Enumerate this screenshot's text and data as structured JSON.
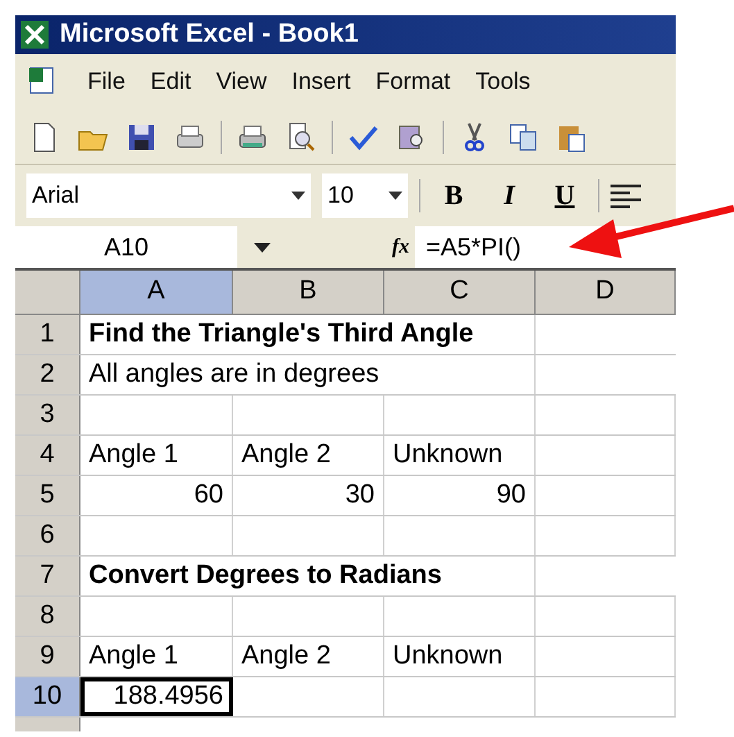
{
  "window": {
    "title": "Microsoft Excel - Book1"
  },
  "menu": [
    {
      "label": "File"
    },
    {
      "label": "Edit"
    },
    {
      "label": "View"
    },
    {
      "label": "Insert"
    },
    {
      "label": "Format"
    },
    {
      "label": "Tools"
    }
  ],
  "formatting": {
    "font": "Arial",
    "size": "10",
    "bold_button": "B",
    "italic_button": "I",
    "underline_button": "U"
  },
  "formula_bar": {
    "name_box": "A10",
    "fx": "fx",
    "formula": "=A5*PI()"
  },
  "columns": [
    {
      "label": "A",
      "selected": true
    },
    {
      "label": "B",
      "selected": false
    },
    {
      "label": "C",
      "selected": false
    },
    {
      "label": "D",
      "selected": false
    }
  ],
  "rows": [
    {
      "number": "1",
      "selected": false,
      "kind": "heading",
      "text": "Find the Triangle's Third Angle"
    },
    {
      "number": "2",
      "selected": false,
      "kind": "note",
      "text": "All angles are in degrees"
    },
    {
      "number": "3",
      "selected": false,
      "kind": "cells",
      "cells": []
    },
    {
      "number": "4",
      "selected": false,
      "kind": "cells",
      "cells": [
        {
          "text": "Angle 1",
          "kind": "label",
          "selected": false
        },
        {
          "text": "Angle 2",
          "kind": "label",
          "selected": false
        },
        {
          "text": "Unknown",
          "kind": "label",
          "selected": false
        }
      ]
    },
    {
      "number": "5",
      "selected": false,
      "kind": "cells",
      "cells": [
        {
          "text": "60",
          "kind": "number",
          "selected": false
        },
        {
          "text": "30",
          "kind": "number",
          "selected": false
        },
        {
          "text": "90",
          "kind": "number",
          "selected": false
        }
      ]
    },
    {
      "number": "6",
      "selected": false,
      "kind": "cells",
      "cells": []
    },
    {
      "number": "7",
      "selected": false,
      "kind": "heading",
      "text": "Convert Degrees to Radians"
    },
    {
      "number": "8",
      "selected": false,
      "kind": "cells",
      "cells": []
    },
    {
      "number": "9",
      "selected": false,
      "kind": "cells",
      "cells": [
        {
          "text": "Angle 1",
          "kind": "label",
          "selected": false
        },
        {
          "text": "Angle 2",
          "kind": "label",
          "selected": false
        },
        {
          "text": "Unknown",
          "kind": "label",
          "selected": false
        }
      ]
    },
    {
      "number": "10",
      "selected": true,
      "kind": "cells",
      "cells": [
        {
          "text": "188.4956",
          "kind": "number",
          "selected": true
        }
      ]
    }
  ]
}
